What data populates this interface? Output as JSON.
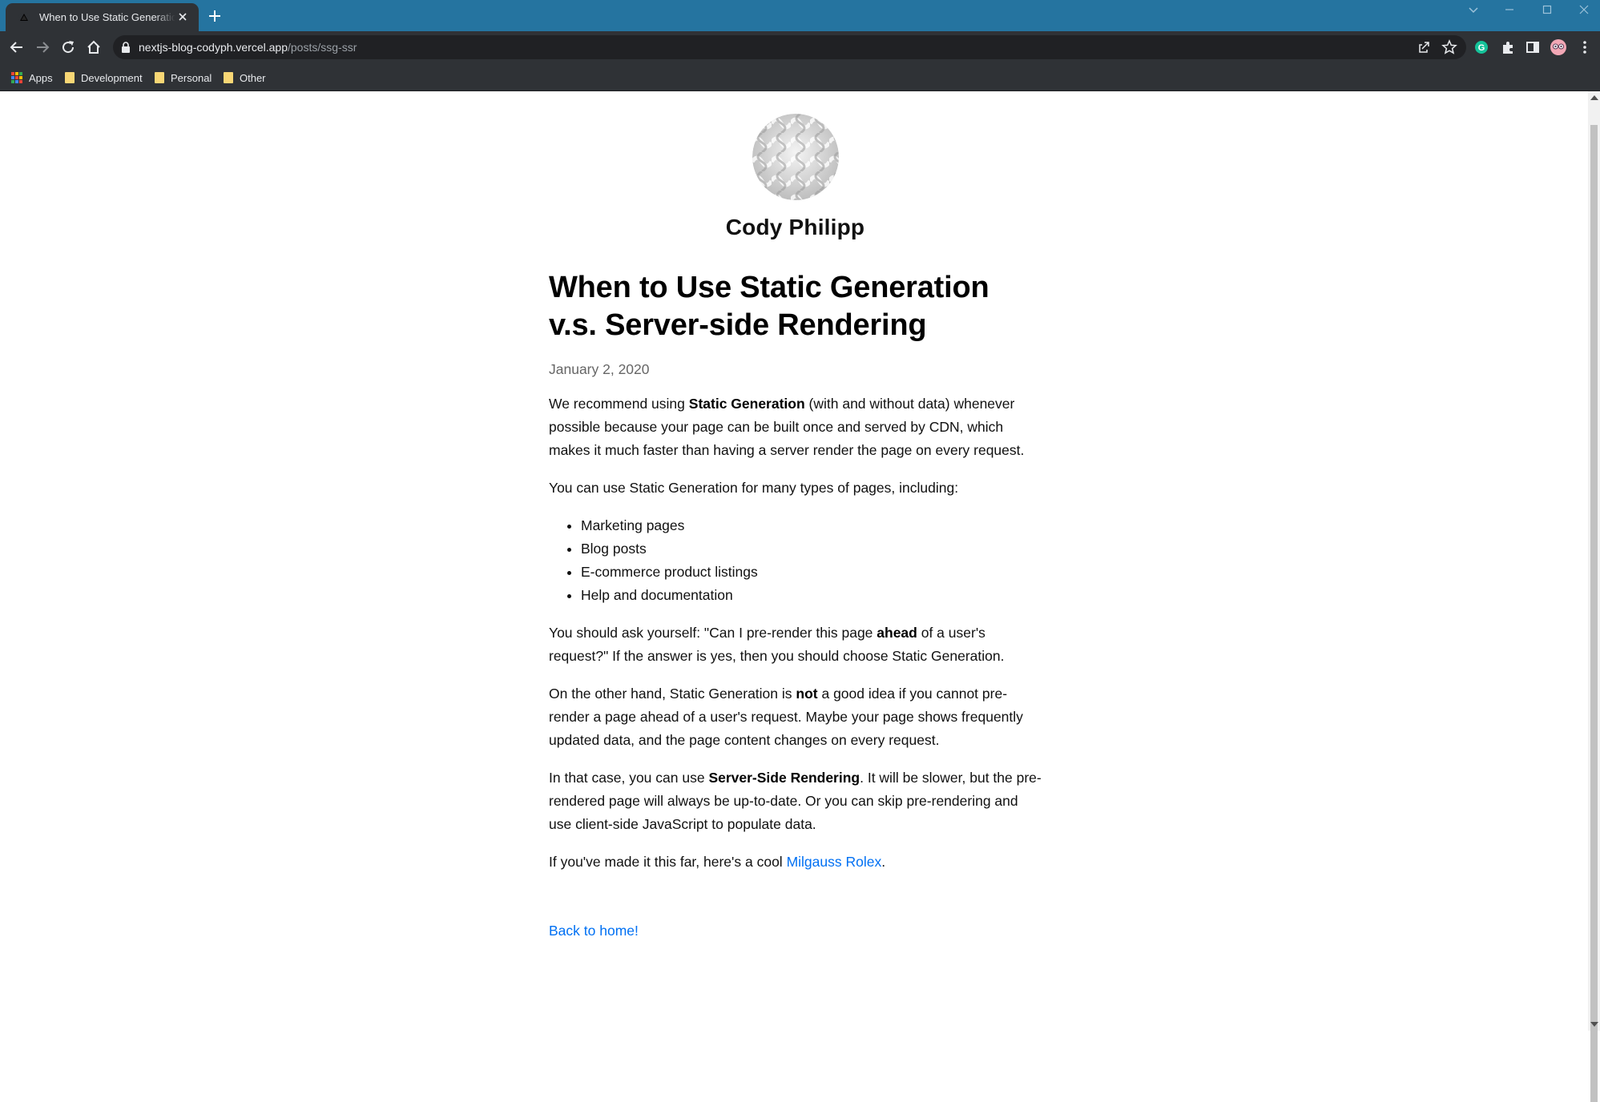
{
  "browser": {
    "tab_title": "When to Use Static Generation v.s. Server-side Rendering",
    "url_host": "nextjs-blog-codyph.vercel.app",
    "url_path": "/posts/ssg-ssr",
    "bookmarks": [
      {
        "label": "Apps",
        "icon": "apps-grid-icon"
      },
      {
        "label": "Development",
        "icon": "folder-icon"
      },
      {
        "label": "Personal",
        "icon": "folder-icon"
      },
      {
        "label": "Other",
        "icon": "folder-icon"
      }
    ]
  },
  "profile": {
    "name": "Cody Philipp"
  },
  "post": {
    "title": "When to Use Static Generation v.s. Server-side Rendering",
    "date": "January 2, 2020",
    "p1": {
      "a": "We recommend using ",
      "b": "Static Generation",
      "c": " (with and without data) whenever possible because your page can be built once and served by CDN, which makes it much faster than having a server render the page on every request."
    },
    "p2": "You can use Static Generation for many types of pages, including:",
    "list": [
      "Marketing pages",
      "Blog posts",
      "E-commerce product listings",
      "Help and documentation"
    ],
    "p3": {
      "a": "You should ask yourself: \"Can I pre-render this page ",
      "b": "ahead",
      "c": " of a user's request?\" If the answer is yes, then you should choose Static Generation."
    },
    "p4": {
      "a": "On the other hand, Static Generation is ",
      "b": "not",
      "c": " a good idea if you cannot pre-render a page ahead of a user's request. Maybe your page shows frequently updated data, and the page content changes on every request."
    },
    "p5": {
      "a": "In that case, you can use ",
      "b": "Server-Side Rendering",
      "c": ". It will be slower, but the pre-rendered page will always be up-to-date. Or you can skip pre-rendering and use client-side JavaScript to populate data."
    },
    "p6": {
      "a": "If you've made it this far, here's a cool ",
      "link": "Milgauss Rolex",
      "c": "."
    },
    "back_link": "Back to home!"
  },
  "colors": {
    "tabbar": "#2574a0",
    "chrome": "#2f3236",
    "link": "#0070f3"
  }
}
